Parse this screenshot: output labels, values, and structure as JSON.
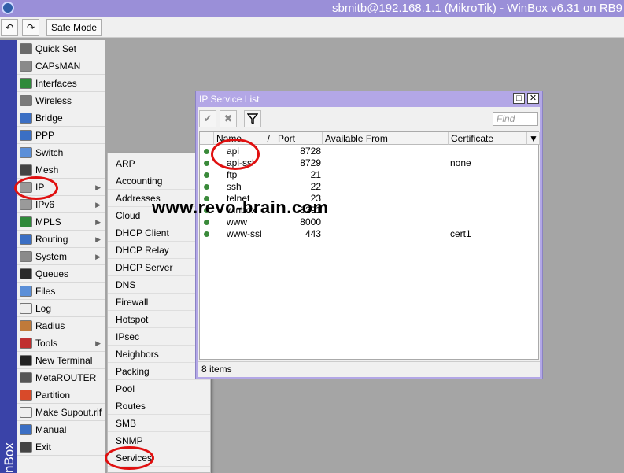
{
  "window": {
    "title": "sbmitb@192.168.1.1 (MikroTik) - WinBox v6.31 on RB9"
  },
  "toolbar": {
    "undo": "↶",
    "redo": "↷",
    "safe_mode": "Safe Mode"
  },
  "sidebar": {
    "brand": "nBox",
    "items": [
      {
        "label": "Quick Set",
        "icon": "quick-set-icon",
        "color": "#6a6a6a",
        "arrow": ""
      },
      {
        "label": "CAPsMAN",
        "icon": "capsman-icon",
        "color": "#8a8a8a",
        "arrow": ""
      },
      {
        "label": "Interfaces",
        "icon": "interfaces-icon",
        "color": "#2f8a3a",
        "arrow": ""
      },
      {
        "label": "Wireless",
        "icon": "wireless-icon",
        "color": "#7a7a7a",
        "arrow": ""
      },
      {
        "label": "Bridge",
        "icon": "bridge-icon",
        "color": "#3b6fc4",
        "arrow": ""
      },
      {
        "label": "PPP",
        "icon": "ppp-icon",
        "color": "#3b6fc4",
        "arrow": ""
      },
      {
        "label": "Switch",
        "icon": "switch-icon",
        "color": "#5b8fd8",
        "arrow": ""
      },
      {
        "label": "Mesh",
        "icon": "mesh-icon",
        "color": "#444444",
        "arrow": ""
      },
      {
        "label": "IP",
        "icon": "ip-icon",
        "color": "#9a9a9a",
        "arrow": "▶"
      },
      {
        "label": "IPv6",
        "icon": "ipv6-icon",
        "color": "#9a9a9a",
        "arrow": "▶"
      },
      {
        "label": "MPLS",
        "icon": "mpls-icon",
        "color": "#2f8a3a",
        "arrow": "▶"
      },
      {
        "label": "Routing",
        "icon": "routing-icon",
        "color": "#3b6fc4",
        "arrow": "▶"
      },
      {
        "label": "System",
        "icon": "system-icon",
        "color": "#8a8a8a",
        "arrow": "▶"
      },
      {
        "label": "Queues",
        "icon": "queues-icon",
        "color": "#2a2a2a",
        "arrow": ""
      },
      {
        "label": "Files",
        "icon": "files-icon",
        "color": "#5b8fd8",
        "arrow": ""
      },
      {
        "label": "Log",
        "icon": "log-icon",
        "color": "#eeeeee",
        "arrow": ""
      },
      {
        "label": "Radius",
        "icon": "radius-icon",
        "color": "#c07a3a",
        "arrow": ""
      },
      {
        "label": "Tools",
        "icon": "tools-icon",
        "color": "#c03030",
        "arrow": "▶"
      },
      {
        "label": "New Terminal",
        "icon": "terminal-icon",
        "color": "#222222",
        "arrow": ""
      },
      {
        "label": "MetaROUTER",
        "icon": "metarouter-icon",
        "color": "#555555",
        "arrow": ""
      },
      {
        "label": "Partition",
        "icon": "partition-icon",
        "color": "#d84a2a",
        "arrow": ""
      },
      {
        "label": "Make Supout.rif",
        "icon": "supout-icon",
        "color": "#eeeeee",
        "arrow": ""
      },
      {
        "label": "Manual",
        "icon": "manual-icon",
        "color": "#3b6fc4",
        "arrow": ""
      },
      {
        "label": "Exit",
        "icon": "exit-icon",
        "color": "#444444",
        "arrow": ""
      }
    ]
  },
  "submenu": {
    "items": [
      "ARP",
      "Accounting",
      "Addresses",
      "Cloud",
      "DHCP Client",
      "DHCP Relay",
      "DHCP Server",
      "DNS",
      "Firewall",
      "Hotspot",
      "IPsec",
      "Neighbors",
      "Packing",
      "Pool",
      "Routes",
      "SMB",
      "SNMP",
      "Services"
    ]
  },
  "service_window": {
    "title": "IP Service List",
    "maximize": "□",
    "close": "✕",
    "find_placeholder": "Find",
    "columns": [
      "Name",
      "Port",
      "Available From",
      "Certificate"
    ],
    "sort_indicator": "/",
    "rows": [
      {
        "name": "api",
        "port": "8728",
        "available_from": "",
        "certificate": ""
      },
      {
        "name": "api-ssl",
        "port": "8729",
        "available_from": "",
        "certificate": "none"
      },
      {
        "name": "ftp",
        "port": "21",
        "available_from": "",
        "certificate": ""
      },
      {
        "name": "ssh",
        "port": "22",
        "available_from": "",
        "certificate": ""
      },
      {
        "name": "telnet",
        "port": "23",
        "available_from": "",
        "certificate": ""
      },
      {
        "name": "winbox",
        "port": "8291",
        "available_from": "",
        "certificate": ""
      },
      {
        "name": "www",
        "port": "8000",
        "available_from": "",
        "certificate": ""
      },
      {
        "name": "www-ssl",
        "port": "443",
        "available_from": "",
        "certificate": "cert1"
      }
    ],
    "status": "8 items"
  },
  "watermark": "www.revo-brain.com",
  "colors": {
    "accent": "#e01010",
    "titlebar": "#9a8fd8",
    "sidebar": "#3a43a8"
  }
}
